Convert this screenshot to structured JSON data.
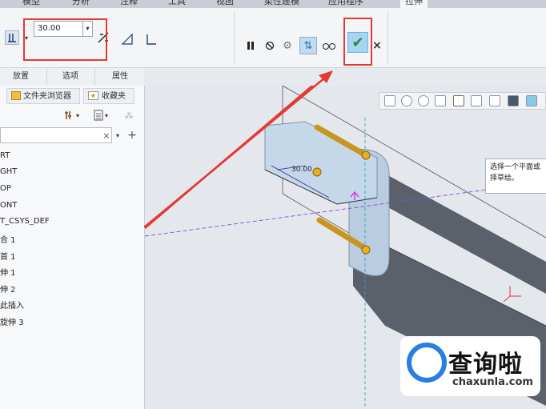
{
  "ribbon_tabs": [
    {
      "label": "模型",
      "active": false
    },
    {
      "label": "分析",
      "active": false
    },
    {
      "label": "注释",
      "active": false
    },
    {
      "label": "工具",
      "active": false
    },
    {
      "label": "视图",
      "active": false
    },
    {
      "label": "柔性建模",
      "active": false
    },
    {
      "label": "应用程序",
      "active": false
    },
    {
      "label": "拉伸",
      "active": true
    }
  ],
  "extrude": {
    "depth_value": "30.00",
    "ok_icon": "check-icon",
    "cancel_label": "×"
  },
  "sub_tabs": [
    "放置",
    "选项",
    "属性"
  ],
  "nav_tabs": [
    "文件夹浏览器",
    "收藏夹"
  ],
  "model_tree": [
    "RT",
    "GHT",
    "OP",
    "ONT",
    "T_CSYS_DEF",
    "合 1",
    "首 1",
    "伸 1",
    "伸 2",
    "此插入",
    "旋伸 3"
  ],
  "dimension_label": "30.00",
  "tooltip": {
    "line1": "选择一个平面或",
    "line2": "择草绘。"
  },
  "watermark": {
    "title": "查询啦",
    "url": "chaxunla.com"
  },
  "colors": {
    "highlight": "#e53935",
    "ok_green": "#1e8a3a",
    "solid": "#5a616b",
    "rod": "#c8961e"
  }
}
